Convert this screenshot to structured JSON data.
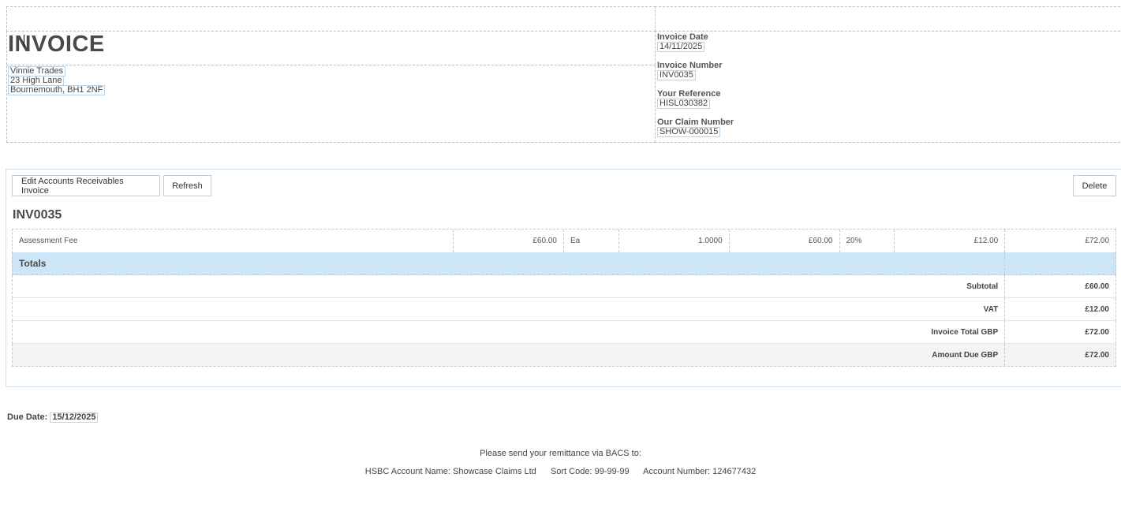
{
  "invoice": {
    "title": "INVOICE",
    "address": [
      "Vinnie Trades",
      "23 High Lane",
      "Bournemouth, BH1 2NF"
    ],
    "meta": [
      {
        "label": "Invoice Date",
        "value": "14/11/2025"
      },
      {
        "label": "Invoice Number",
        "value": "INV0035"
      },
      {
        "label": "Your Reference",
        "value": "HISL030382"
      },
      {
        "label": "Our Claim Number",
        "value": "SHOW-000015"
      }
    ]
  },
  "toolbar": {
    "edit_label": "Edit Accounts Receivables Invoice",
    "refresh_label": "Refresh",
    "delete_label": "Delete"
  },
  "panel": {
    "heading": "INV0035",
    "line_item": {
      "description": "Assessment Fee",
      "unit_price": "£60.00",
      "unit": "Ea",
      "quantity": "1.0000",
      "net": "£60.00",
      "vat_rate": "20%",
      "vat": "£12.00",
      "total": "£72.00"
    },
    "totals_label": "Totals",
    "totals": [
      {
        "label": "Subtotal",
        "value": "£60.00"
      },
      {
        "label": "VAT",
        "value": "£12.00"
      },
      {
        "label": "Invoice Total GBP",
        "value": "£72.00"
      },
      {
        "label": "Amount Due GBP",
        "value": "£72.00"
      }
    ]
  },
  "footer": {
    "due_label": "Due Date:",
    "due_value": "15/12/2025",
    "remittance_text": "Please send your remittance via BACS to:",
    "bank_name": "HSBC Account Name: Showcase Claims Ltd",
    "sort_code": "Sort Code: 99-99-99",
    "account_number": "Account Number: 124677432"
  }
}
